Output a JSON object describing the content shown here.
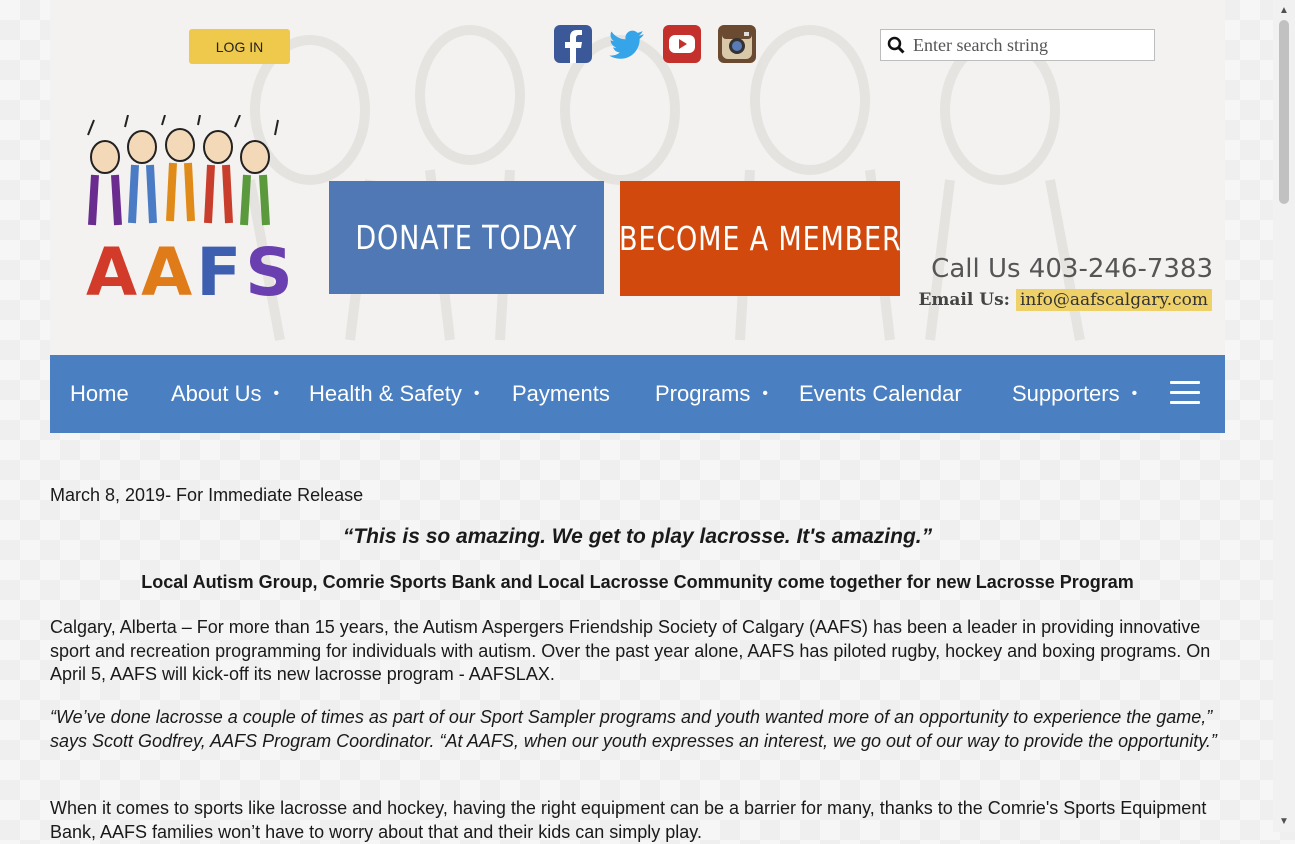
{
  "header": {
    "login_label": "LOG IN",
    "search_placeholder": "Enter search string",
    "logo_text": "AAFS",
    "donate_label": "DONATE TODAY",
    "member_label": "BECOME A MEMBER",
    "call_text": "Call Us 403-246-7383",
    "email_label": "Email Us:",
    "email_address": "info@aafscalgary.com",
    "social": [
      "facebook-icon",
      "twitter-icon",
      "youtube-icon",
      "instagram-icon"
    ]
  },
  "nav": {
    "items": [
      {
        "label": "Home"
      },
      {
        "label": "About Us"
      },
      {
        "label": "Health & Safety"
      },
      {
        "label": "Payments"
      },
      {
        "label": "Programs"
      },
      {
        "label": "Events Calendar"
      },
      {
        "label": "Supporters"
      }
    ],
    "dot": "•"
  },
  "article": {
    "release_line": "March 8, 2019- For Immediate Release",
    "quote": "“This is so amazing. We get to play lacrosse. It's amazing.”",
    "subhead": "Local Autism Group, Comrie Sports Bank and Local Lacrosse Community come together for new Lacrosse Program",
    "p1": "Calgary, Alberta – For more than 15 years, the Autism Aspergers Friendship Society of Calgary (AAFS) has been a leader in providing innovative sport and recreation programming for individuals with autism. Over the past year alone, AAFS has piloted rugby, hockey and boxing programs.  On April 5, AAFS will kick-off its new lacrosse program - AAFSLAX.",
    "p2": "“We’ve done lacrosse a couple of times as part of our Sport Sampler programs and youth wanted more of an opportunity to experience the game,” says Scott Godfrey, AAFS Program Coordinator. “At AAFS, when our youth expresses an interest, we go out of our way to provide the opportunity.”",
    "p3": "When it comes to sports like lacrosse and hockey, having the right equipment can be a barrier for many, thanks to the Comrie's Sports Equipment Bank, AAFS families won’t have to worry about that and their kids can simply play."
  },
  "colors": {
    "nav_bg": "#4a7fc1",
    "donate_bg": "#4f78b4",
    "member_bg": "#d2490d",
    "login_bg": "#efc94c",
    "email_highlight": "#efd16a",
    "logo_letters": [
      "#d23b2a",
      "#e07b1a",
      "#4a6fc7",
      "#6a3fb0"
    ]
  }
}
